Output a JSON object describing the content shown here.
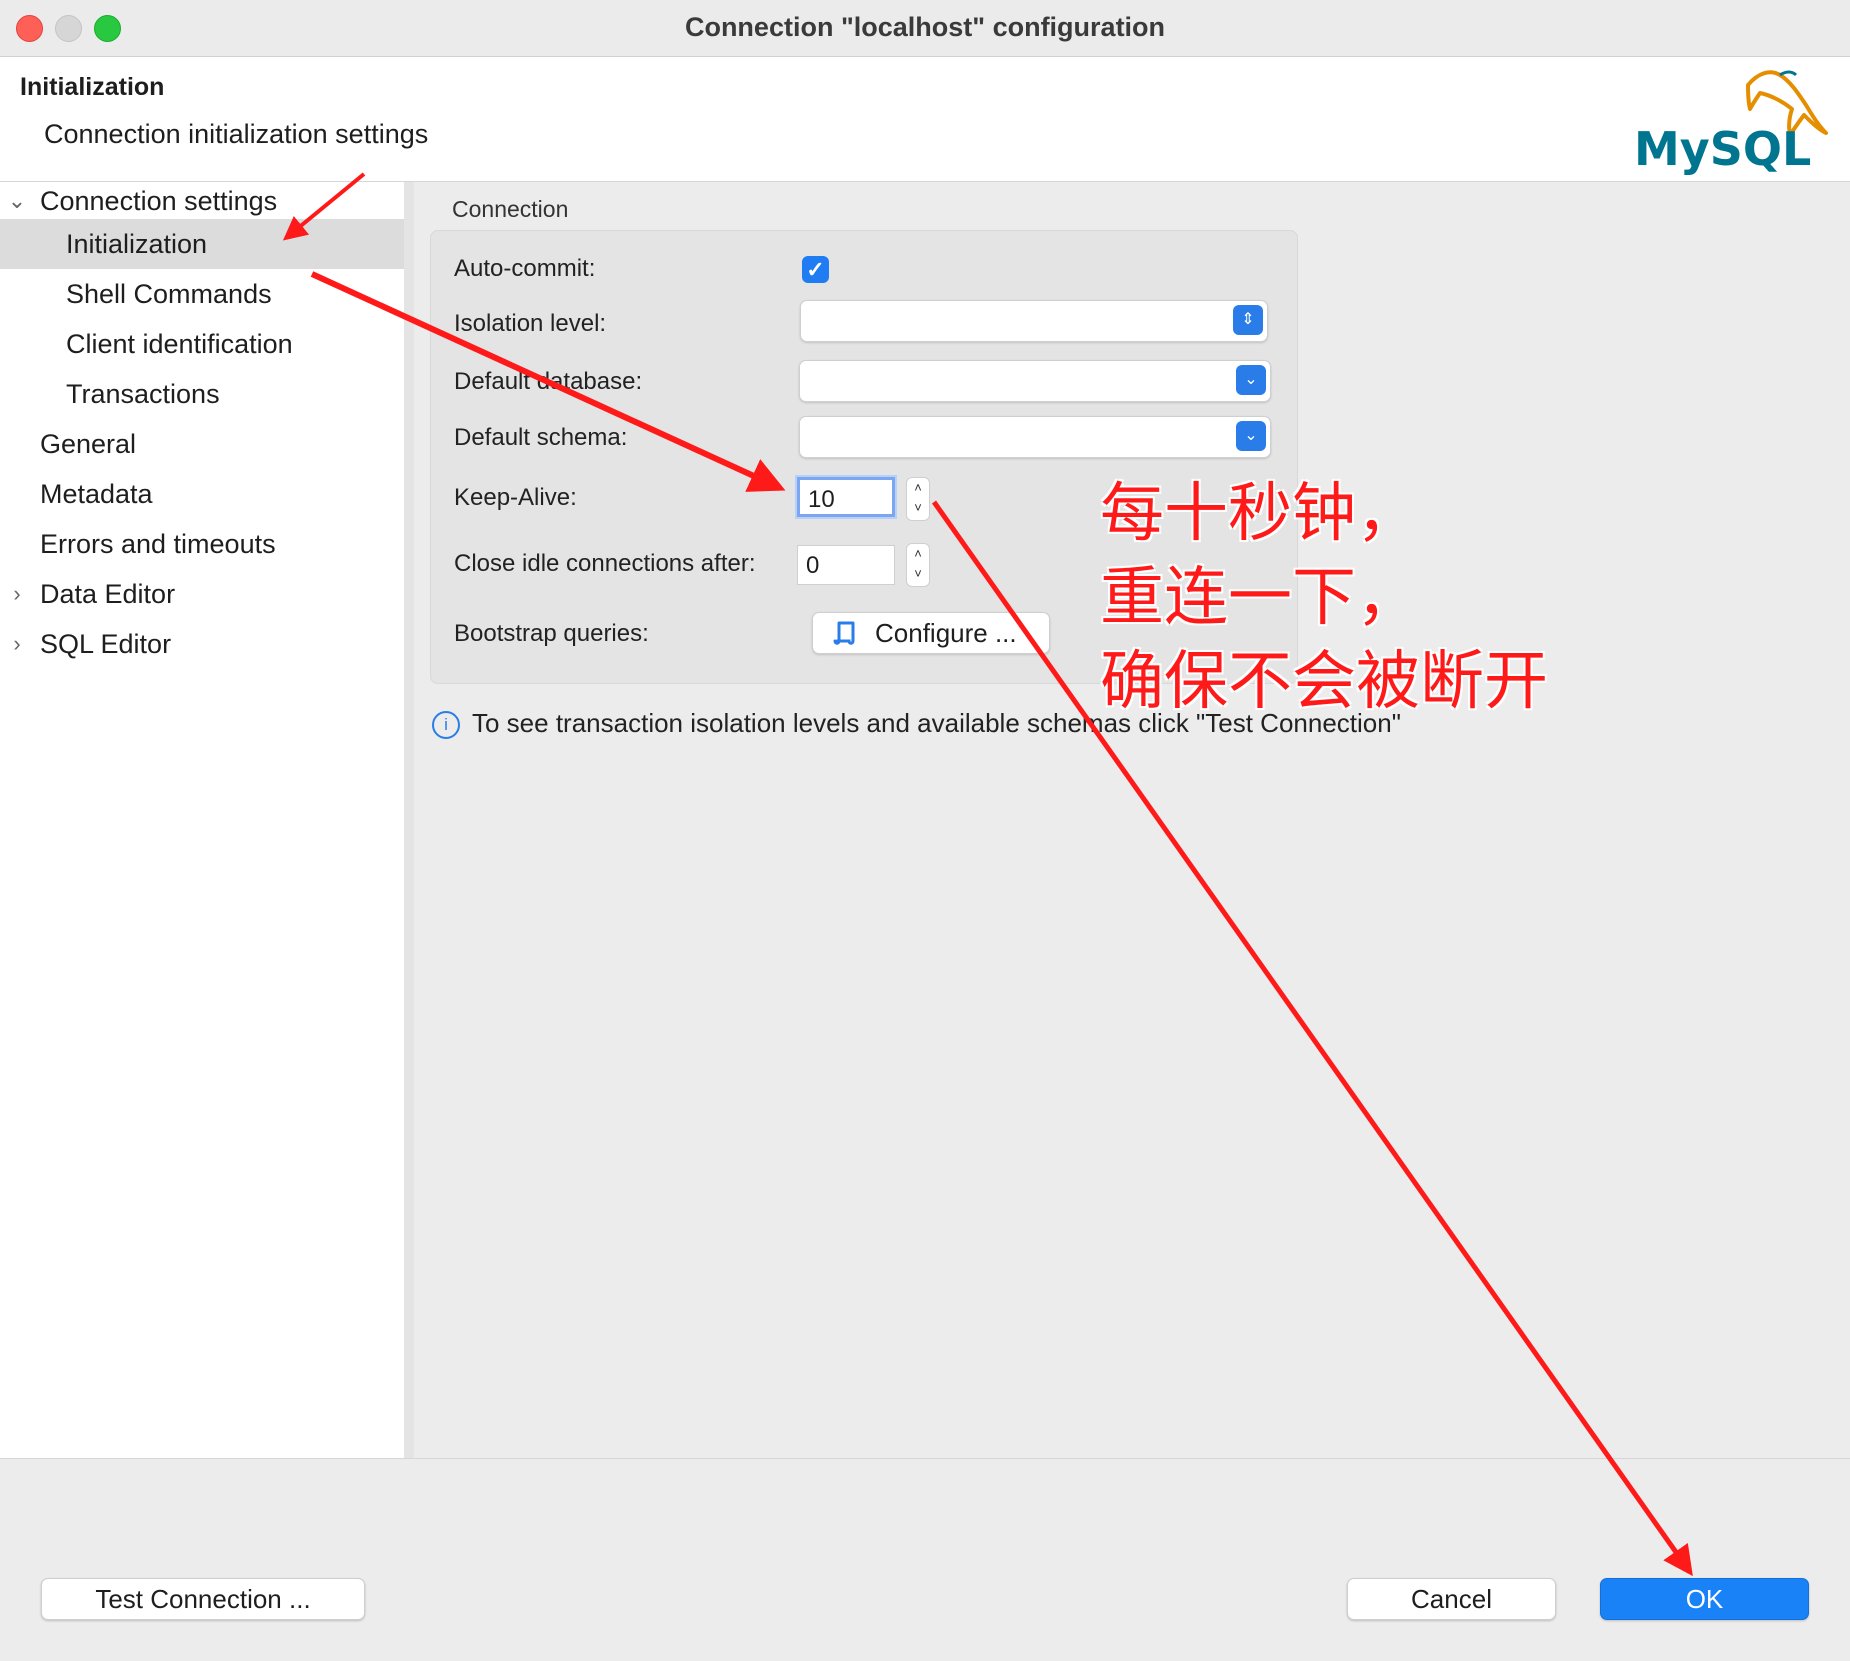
{
  "window": {
    "title": "Connection \"localhost\" configuration"
  },
  "header": {
    "title": "Initialization",
    "subtitle": "Connection initialization settings",
    "logo_text": "MySQL"
  },
  "sidebar": {
    "items": [
      {
        "label": "Connection settings",
        "expanded": true
      },
      {
        "label": "Initialization",
        "selected": true
      },
      {
        "label": "Shell Commands"
      },
      {
        "label": "Client identification"
      },
      {
        "label": "Transactions"
      },
      {
        "label": "General"
      },
      {
        "label": "Metadata"
      },
      {
        "label": "Errors and timeouts"
      },
      {
        "label": "Data Editor",
        "expanded": false
      },
      {
        "label": "SQL Editor",
        "expanded": false
      }
    ]
  },
  "connection": {
    "group_title": "Connection",
    "auto_commit_label": "Auto-commit:",
    "auto_commit": true,
    "isolation_level_label": "Isolation level:",
    "isolation_level": "",
    "default_database_label": "Default database:",
    "default_database": "",
    "default_schema_label": "Default schema:",
    "default_schema": "",
    "keep_alive_label": "Keep-Alive:",
    "keep_alive": "10",
    "close_idle_label": "Close idle connections after:",
    "close_idle": "0",
    "bootstrap_label": "Bootstrap queries:",
    "configure_button": "Configure ..."
  },
  "info_text": "To see transaction isolation levels and available schemas click \"Test Connection\"",
  "footer": {
    "test_connection": "Test Connection ...",
    "cancel": "Cancel",
    "ok": "OK"
  },
  "annotation": {
    "line1": "每十秒钟，",
    "line2": "重连一下，",
    "line3": "确保不会被断开",
    "color": "#ff1a1a"
  },
  "colors": {
    "accent": "#1a82f7",
    "selection": "#dcdcdc"
  }
}
